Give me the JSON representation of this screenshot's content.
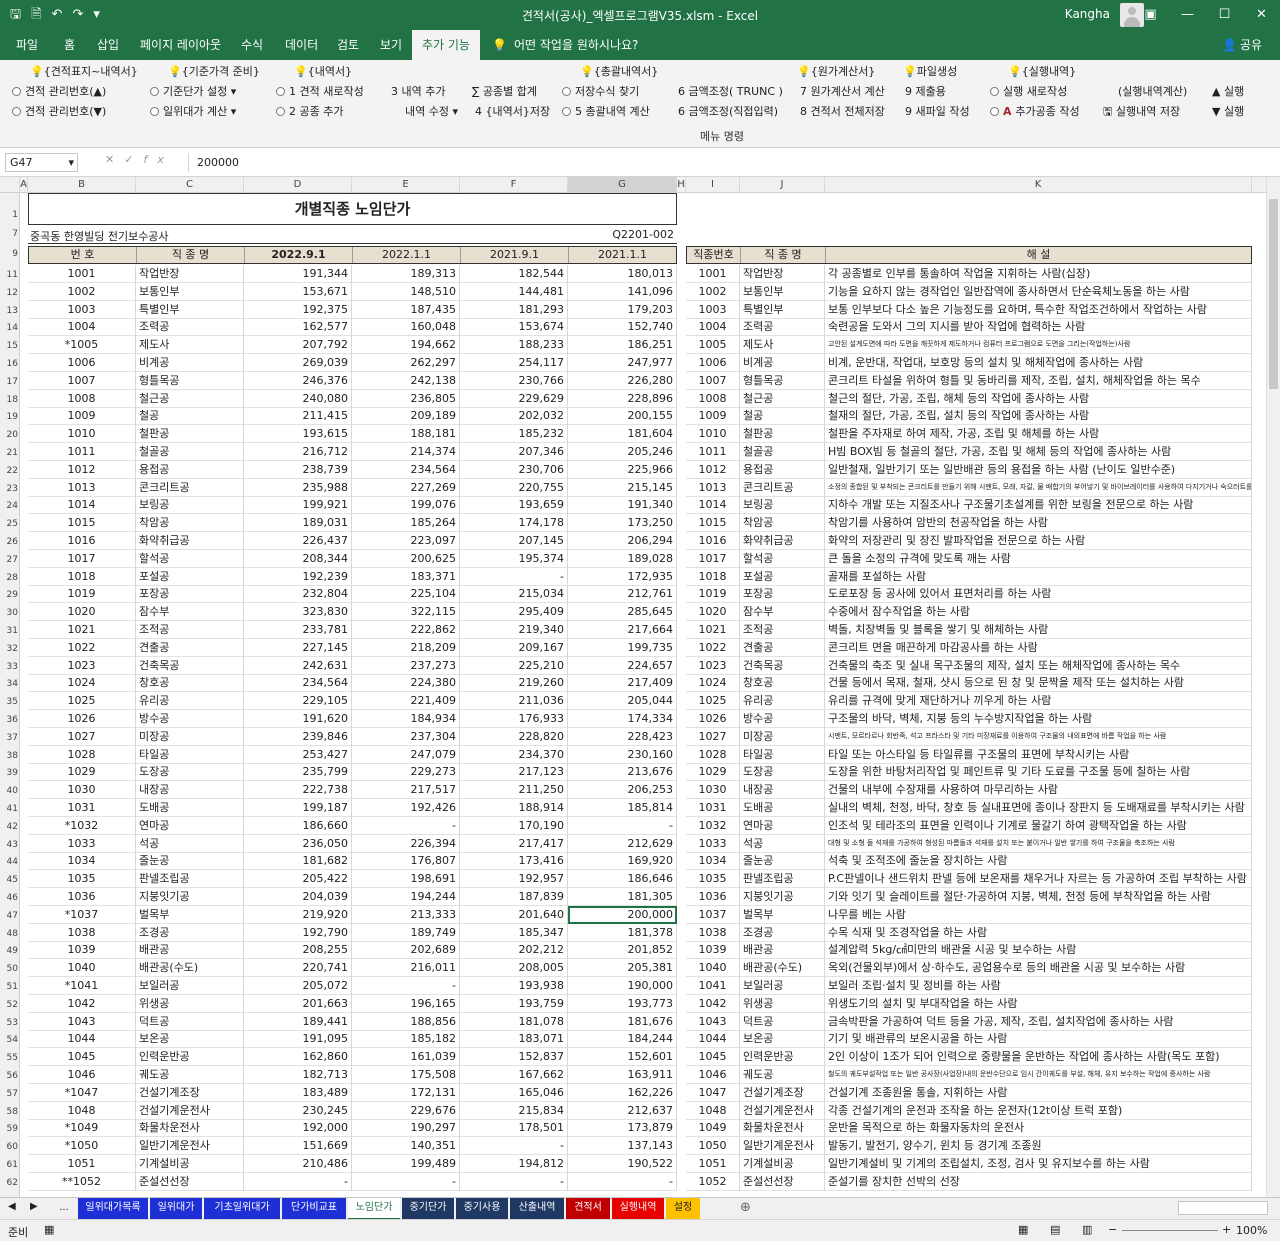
{
  "window": {
    "title": "견적서(공사)_엑셀프로그램V35.xlsm - Excel",
    "user": "Kangha"
  },
  "tabs": [
    {
      "label": "파일"
    },
    {
      "label": "홈"
    },
    {
      "label": "삽입"
    },
    {
      "label": "페이지 레이아웃"
    },
    {
      "label": "수식"
    },
    {
      "label": "데이터"
    },
    {
      "label": "검토"
    },
    {
      "label": "보기"
    },
    {
      "label": "추가 기능"
    },
    {
      "label": "어떤 작업을 원하시나요?"
    },
    {
      "label": "공유"
    }
  ],
  "ribbon": {
    "group_headers": [
      "{견적표지~내역서}",
      "{기준가격 준비}",
      "{내역서}",
      "{총괄내역서}",
      "{원가계산서}",
      "파일생성",
      "{실행내역}"
    ],
    "row1": [
      "견적 관리번호(▲)",
      "기준단가 설정",
      "1 견적 새로작성",
      "3 내역 추가",
      "공종별 합계",
      "저장수식 찾기",
      "6 금액조정( TRUNC )",
      "7 원가계산서 계산",
      "9 제출용",
      "실행 새로작성",
      "(실행내역계산)",
      "실행"
    ],
    "row2": [
      "견적 관리번호(▼)",
      "일위대가 계산",
      "2 공종 추가",
      "내역 수정",
      "4 {내역서}저장",
      "5 총괄내역 계산",
      "6 금액조정(직접입력)",
      "8 견적서 전체저장",
      "9 새파일 작성",
      "추가공종 작성",
      "실행내역 저장",
      "실행"
    ],
    "menu_label": "메뉴 명령"
  },
  "formula_bar": {
    "cell": "G47",
    "value": "200000"
  },
  "columns": [
    "A",
    "B",
    "C",
    "D",
    "E",
    "F",
    "G",
    "H",
    "I",
    "J",
    "K"
  ],
  "sheet": {
    "title": "개별직종 노임단가",
    "project": "중곡동 한영빌딩 전기보수공사",
    "code": "Q2201-002",
    "left_headers": [
      "번 호",
      "직 종 명",
      "2022.9.1",
      "2022.1.1",
      "2021.9.1",
      "2021.1.1"
    ],
    "right_headers": [
      "직종번호",
      "직 종 명",
      "해 설"
    ]
  },
  "row_numbers": [
    "1",
    "7",
    "9",
    "11",
    "12",
    "13",
    "14",
    "15",
    "16",
    "17",
    "18",
    "19",
    "20",
    "21",
    "22",
    "23",
    "24",
    "25",
    "26",
    "27",
    "28",
    "29",
    "30",
    "31",
    "32",
    "33",
    "34",
    "35",
    "36",
    "37",
    "38",
    "39",
    "40",
    "41",
    "42",
    "43",
    "44",
    "45",
    "46",
    "47",
    "48",
    "49",
    "50",
    "51",
    "52",
    "53",
    "54",
    "55",
    "56",
    "57",
    "58",
    "59",
    "60",
    "61",
    "62"
  ],
  "rows": [
    {
      "no": "1001",
      "name": "작업반장",
      "d": "191,344",
      "e": "189,313",
      "f": "182,544",
      "g": "180,013",
      "desc": "각 공종별로 인부를 통솔하여 작업을 지휘하는 사람(십장)"
    },
    {
      "no": "1002",
      "name": "보통인부",
      "d": "153,671",
      "e": "148,510",
      "f": "144,481",
      "g": "141,096",
      "desc": "기능을 요하지 않는 경작업인 일반잡역에 종사하면서 단순육체노동을 하는 사람"
    },
    {
      "no": "1003",
      "name": "특별인부",
      "d": "192,375",
      "e": "187,435",
      "f": "181,293",
      "g": "179,203",
      "desc": "보통 인부보다 다소 높은 기능정도를 요하며, 특수한 작업조건하에서 작업하는 사람"
    },
    {
      "no": "1004",
      "name": "조력공",
      "d": "162,577",
      "e": "160,048",
      "f": "153,674",
      "g": "152,740",
      "desc": "숙련공을 도와서 그의 지시를 받아 작업에 협력하는 사람"
    },
    {
      "no": "*1005",
      "name": "제도사",
      "d": "207,792",
      "e": "194,662",
      "f": "188,233",
      "g": "186,251",
      "desc": "고안된 설계도면에 따라 도면을 깨끗하게 제도하거나 컴퓨터 프로그램으로 도면을 그리는(작업하는)사람",
      "tiny": true
    },
    {
      "no": "1006",
      "name": "비계공",
      "d": "269,039",
      "e": "262,297",
      "f": "254,117",
      "g": "247,977",
      "desc": "비계, 운반대, 작업대, 보호망 등의 설치 및 해체작업에 종사하는 사람"
    },
    {
      "no": "1007",
      "name": "형틀목공",
      "d": "246,376",
      "e": "242,138",
      "f": "230,766",
      "g": "226,280",
      "desc": "콘크리트 타설을 위하여 형틀 및 동바리를 제작, 조립, 설치, 해체작업을 하는 목수"
    },
    {
      "no": "1008",
      "name": "철근공",
      "d": "240,080",
      "e": "236,805",
      "f": "229,629",
      "g": "228,896",
      "desc": "철근의 절단, 가공, 조립, 해체 등의 작업에 종사하는 사람"
    },
    {
      "no": "1009",
      "name": "철공",
      "d": "211,415",
      "e": "209,189",
      "f": "202,032",
      "g": "200,155",
      "desc": "철재의 절단, 가공, 조립, 설치 등의 작업에 종사하는 사람"
    },
    {
      "no": "1010",
      "name": "철판공",
      "d": "193,615",
      "e": "188,181",
      "f": "185,232",
      "g": "181,604",
      "desc": "철판을 주자재로 하여 제작, 가공, 조립 및 해체를 하는 사람"
    },
    {
      "no": "1011",
      "name": "철골공",
      "d": "216,712",
      "e": "214,374",
      "f": "207,346",
      "g": "205,246",
      "desc": "H빔 BOX빔 등 철골의 절단, 가공, 조립 및 해체 등의 작업에 종사하는 사람"
    },
    {
      "no": "1012",
      "name": "용접공",
      "d": "238,739",
      "e": "234,564",
      "f": "230,706",
      "g": "225,966",
      "desc": "일반철재, 일반기기 또는 일반배관 등의 용접을 하는 사람 (난이도 일반수준)"
    },
    {
      "no": "1013",
      "name": "콘크리트공",
      "d": "235,988",
      "e": "227,269",
      "f": "220,755",
      "g": "215,145",
      "desc": "소정의 종합된 및 부착되는 콘크리트를 만들기 위해 시멘트, 모래, 자갈, 물 배합기의 부어넣기 및 바이브레이터를 사용하여 다지기거나 숙으러트를 부치하는 사람",
      "tiny": true
    },
    {
      "no": "1014",
      "name": "보링공",
      "d": "199,921",
      "e": "199,076",
      "f": "193,659",
      "g": "191,340",
      "desc": "지하수 개발 또는 지질조사나 구조물기초설계를 위한 보링을 전문으로 하는 사람"
    },
    {
      "no": "1015",
      "name": "착암공",
      "d": "189,031",
      "e": "185,264",
      "f": "174,178",
      "g": "173,250",
      "desc": "착암기를 사용하여 암반의 천공작업을 하는 사람"
    },
    {
      "no": "1016",
      "name": "화약취급공",
      "d": "226,437",
      "e": "223,097",
      "f": "207,145",
      "g": "206,294",
      "desc": "화약의 저장관리 및 장진 발파작업을 전문으로 하는 사람"
    },
    {
      "no": "1017",
      "name": "할석공",
      "d": "208,344",
      "e": "200,625",
      "f": "195,374",
      "g": "189,028",
      "desc": "큰 돌을 소정의 규격에 맞도록 깨는 사람"
    },
    {
      "no": "1018",
      "name": "포설공",
      "d": "192,239",
      "e": "183,371",
      "f": "-",
      "g": "172,935",
      "desc": "골재를 포설하는 사람"
    },
    {
      "no": "1019",
      "name": "포장공",
      "d": "232,804",
      "e": "225,104",
      "f": "215,034",
      "g": "212,761",
      "desc": "도로포장 등 공사에 있어서 표면처리를 하는 사람"
    },
    {
      "no": "1020",
      "name": "잠수부",
      "d": "323,830",
      "e": "322,115",
      "f": "295,409",
      "g": "285,645",
      "desc": "수중에서 잠수작업을 하는 사람"
    },
    {
      "no": "1021",
      "name": "조적공",
      "d": "233,781",
      "e": "222,862",
      "f": "219,340",
      "g": "217,664",
      "desc": "벽돌, 치장벽돌 및 블록을 쌓기 및 해체하는 사람"
    },
    {
      "no": "1022",
      "name": "견출공",
      "d": "227,145",
      "e": "218,209",
      "f": "209,167",
      "g": "199,735",
      "desc": "콘크리트 면을 매끈하게 마감공사를 하는 사람"
    },
    {
      "no": "1023",
      "name": "건축목공",
      "d": "242,631",
      "e": "237,273",
      "f": "225,210",
      "g": "224,657",
      "desc": "건축물의 축조 및 실내 목구조물의 제작, 설치 또는 해체작업에 종사하는 목수"
    },
    {
      "no": "1024",
      "name": "창호공",
      "d": "234,564",
      "e": "224,380",
      "f": "219,260",
      "g": "217,409",
      "desc": "건물 등에서 목재, 철재, 샷시 등으로 된 창 및 문짝을 제작 또는 설치하는 사람"
    },
    {
      "no": "1025",
      "name": "유리공",
      "d": "229,105",
      "e": "221,409",
      "f": "211,036",
      "g": "205,044",
      "desc": "유리를 규격에 맞게 재단하거나 끼우게 하는 사람"
    },
    {
      "no": "1026",
      "name": "방수공",
      "d": "191,620",
      "e": "184,934",
      "f": "176,933",
      "g": "174,334",
      "desc": "구조물의 바닥, 벽체, 지붕 등의 누수방지작업을 하는 사람"
    },
    {
      "no": "1027",
      "name": "미장공",
      "d": "239,846",
      "e": "237,304",
      "f": "228,820",
      "g": "228,423",
      "desc": "시멘트, 모르타르나 회반죽, 석고 프라스타 및 기타 미장재료를 이용하여 구조물의 내외표면에 바름 작업을 하는 사람",
      "tiny": true
    },
    {
      "no": "1028",
      "name": "타일공",
      "d": "253,427",
      "e": "247,079",
      "f": "234,370",
      "g": "230,160",
      "desc": "타일 또는 아스타일 등 타일류를 구조물의 표면에 부착시키는 사람"
    },
    {
      "no": "1029",
      "name": "도장공",
      "d": "235,799",
      "e": "229,273",
      "f": "217,123",
      "g": "213,676",
      "desc": "도장을 위한 바탕처리작업 및 페인트류 및 기타 도료를 구조물 등에 칠하는 사람"
    },
    {
      "no": "1030",
      "name": "내장공",
      "d": "222,738",
      "e": "217,517",
      "f": "211,250",
      "g": "206,253",
      "desc": "건물의 내부에 수장재를 사용하여 마무리하는 사람"
    },
    {
      "no": "1031",
      "name": "도배공",
      "d": "199,187",
      "e": "192,426",
      "f": "188,914",
      "g": "185,814",
      "desc": "실내의 벽체, 천정, 바닥, 창호 등 실내표면에 종이나 장판지 등 도배재료를 부착시키는 사람"
    },
    {
      "no": "*1032",
      "name": "연마공",
      "d": "186,660",
      "e": "-",
      "f": "170,190",
      "g": "-",
      "desc": "인조석 및 테라조의 표면을 인력이나 기계로 물갈기 하여 광택작업을 하는 사람"
    },
    {
      "no": "1033",
      "name": "석공",
      "d": "236,050",
      "e": "226,394",
      "f": "217,417",
      "g": "212,629",
      "desc": "대형 및 소형 돌 석재를 가공하여 형성된 마름돌과 석재를 설치 또는 붙이거나 일반 쌓기를 하여 구조물을 축조하는 사람",
      "tiny": true
    },
    {
      "no": "1034",
      "name": "줄눈공",
      "d": "181,682",
      "e": "176,807",
      "f": "173,416",
      "g": "169,920",
      "desc": "석축 및 조적조에 줄눈을 장치하는 사람"
    },
    {
      "no": "1035",
      "name": "판넬조립공",
      "d": "205,422",
      "e": "198,691",
      "f": "192,957",
      "g": "186,646",
      "desc": "P.C판넬이나 샌드위치 판넬 등에 보온재를 채우거나 자르는 등 가공하여 조립 부착하는 사람"
    },
    {
      "no": "1036",
      "name": "지붕잇기공",
      "d": "204,039",
      "e": "194,244",
      "f": "187,839",
      "g": "181,305",
      "desc": "기와 잇기 및 슬레이트를 절단·가공하여 지붕, 벽체, 천정 등에 부착작업을 하는 사람"
    },
    {
      "no": "*1037",
      "name": "벌목부",
      "d": "219,920",
      "e": "213,333",
      "f": "201,640",
      "g": "200,000",
      "desc": "나무를 베는 사람",
      "sel": true
    },
    {
      "no": "1038",
      "name": "조경공",
      "d": "192,790",
      "e": "189,749",
      "f": "185,347",
      "g": "181,378",
      "desc": "수목 식재 및 조경작업을 하는 사람"
    },
    {
      "no": "1039",
      "name": "배관공",
      "d": "208,255",
      "e": "202,689",
      "f": "202,212",
      "g": "201,852",
      "desc": "설계압력 5kg/㎠미만의 배관을 시공 및 보수하는 사람"
    },
    {
      "no": "1040",
      "name": "배관공(수도)",
      "d": "220,741",
      "e": "216,011",
      "f": "208,005",
      "g": "205,381",
      "desc": "옥외(건물외부)에서 상·하수도, 공업용수로 등의 배관을 시공 및 보수하는 사람"
    },
    {
      "no": "*1041",
      "name": "보일러공",
      "d": "205,072",
      "e": "-",
      "f": "193,938",
      "g": "190,000",
      "desc": "보일러 조립·설치 및 정비를 하는 사람"
    },
    {
      "no": "1042",
      "name": "위생공",
      "d": "201,663",
      "e": "196,165",
      "f": "193,759",
      "g": "193,773",
      "desc": "위생도기의 설치 및 부대작업을 하는 사람"
    },
    {
      "no": "1043",
      "name": "덕트공",
      "d": "189,441",
      "e": "188,856",
      "f": "181,078",
      "g": "181,676",
      "desc": "금속박판을 가공하여 덕트 등을 가공, 제작, 조립, 설치작업에 종사하는 사람"
    },
    {
      "no": "1044",
      "name": "보온공",
      "d": "191,095",
      "e": "185,182",
      "f": "183,071",
      "g": "184,244",
      "desc": "기기 및 배관류의 보온시공을 하는 사람"
    },
    {
      "no": "1045",
      "name": "인력운반공",
      "d": "162,860",
      "e": "161,039",
      "f": "152,837",
      "g": "152,601",
      "desc": "2인 이상이 1조가 되어 인력으로 중량물을 운반하는 작업에 종사하는 사람(목도 포함)"
    },
    {
      "no": "1046",
      "name": "궤도공",
      "d": "182,713",
      "e": "175,508",
      "f": "167,662",
      "g": "163,911",
      "desc": "철도의 궤도부설작업 또는 일반 공사장(사업장)내의 운반수단으로 임시 간이궤도를 부설, 해체, 유지 보수하는 작업에 종사하는 사람",
      "tiny": true
    },
    {
      "no": "*1047",
      "name": "건설기계조장",
      "d": "183,489",
      "e": "172,131",
      "f": "165,046",
      "g": "162,226",
      "desc": "건설기계 조종원을 통솔, 지휘하는 사람"
    },
    {
      "no": "1048",
      "name": "건설기계운전사",
      "d": "230,245",
      "e": "229,676",
      "f": "215,834",
      "g": "212,637",
      "desc": "각종 건설기계의 운전과 조작을 하는 운전자(12t이상 트럭 포함)"
    },
    {
      "no": "*1049",
      "name": "화물차운전사",
      "d": "192,000",
      "e": "190,297",
      "f": "178,501",
      "g": "173,879",
      "desc": "운반을 목적으로 하는 화물자동차의 운전사"
    },
    {
      "no": "*1050",
      "name": "일반기계운전사",
      "d": "151,669",
      "e": "140,351",
      "f": "-",
      "g": "137,143",
      "desc": "발동기, 발전기, 양수기, 윈치 등 경기계 조종원"
    },
    {
      "no": "1051",
      "name": "기계설비공",
      "d": "210,486",
      "e": "199,489",
      "f": "194,812",
      "g": "190,522",
      "desc": "일반기계설비 및 기계의 조립설치, 조정, 검사 및 유지보수를 하는 사람"
    },
    {
      "no": "**1052",
      "name": "준설선선장",
      "d": "-",
      "e": "-",
      "f": "-",
      "g": "-",
      "desc": "준설기를 장치한 선박의 선장"
    }
  ],
  "sheet_tabs": [
    {
      "label": "...",
      "bg": "#f0f0f0",
      "fg": "#222"
    },
    {
      "label": "일위대가목록",
      "bg": "#1f2fd6",
      "fg": "#ffffff"
    },
    {
      "label": "일위대가",
      "bg": "#1f2fd6",
      "fg": "#ffffff"
    },
    {
      "label": "기초일위대가",
      "bg": "#1f2fd6",
      "fg": "#ffffff"
    },
    {
      "label": "단가비교표",
      "bg": "#1f2fd6",
      "fg": "#ffffff"
    },
    {
      "label": "노임단가",
      "bg": "#ffffff",
      "fg": "#217346"
    },
    {
      "label": "중기단가",
      "bg": "#1f3864",
      "fg": "#ffffff"
    },
    {
      "label": "중기사용",
      "bg": "#1f3864",
      "fg": "#ffffff"
    },
    {
      "label": "산출내역",
      "bg": "#1f3864",
      "fg": "#ffffff"
    },
    {
      "label": "견적서",
      "bg": "#c00000",
      "fg": "#ffffff"
    },
    {
      "label": "실행내역",
      "bg": "#e60000",
      "fg": "#ffffff"
    },
    {
      "label": "설정",
      "bg": "#ffc000",
      "fg": "#222222"
    }
  ],
  "status": {
    "ready": "준비",
    "zoom": "100%"
  }
}
